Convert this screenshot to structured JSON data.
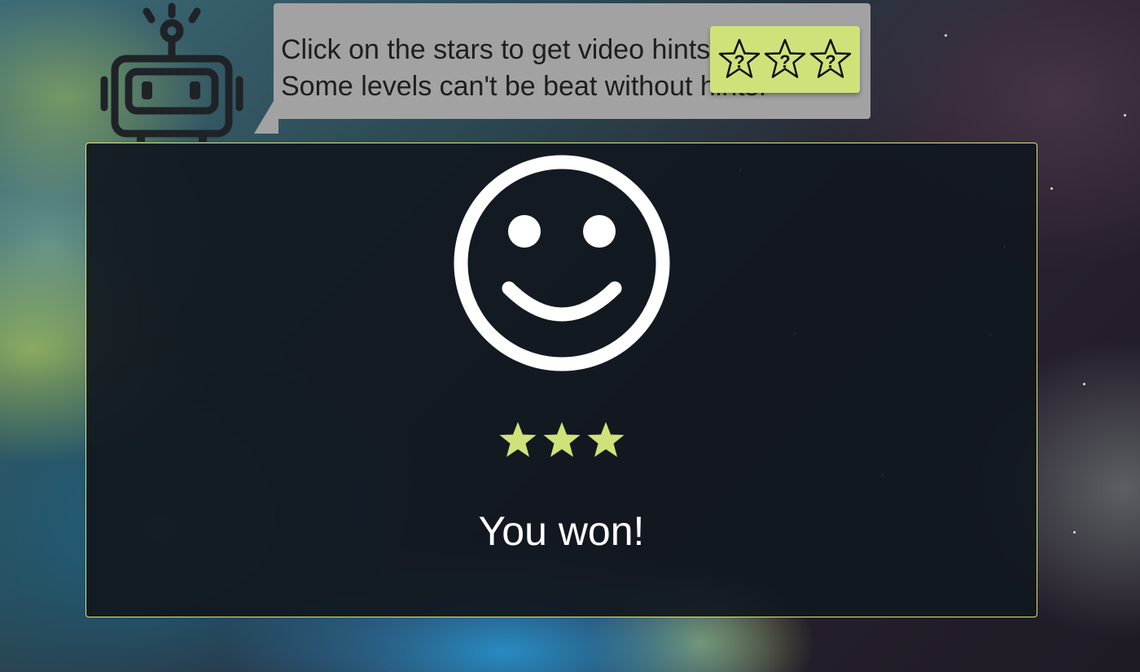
{
  "hint_bubble": {
    "line1": "Click on the stars to get video hints.",
    "line2": "Some levels can't be beat without hints."
  },
  "hint_button": {
    "stars": [
      "?",
      "?",
      "?"
    ],
    "color": "#cfe27a"
  },
  "result_panel": {
    "message": "You won!",
    "stars_earned": 3,
    "stars_total": 3,
    "accent_color": "#d6e86d",
    "face_icon": "smiley-face-icon"
  }
}
